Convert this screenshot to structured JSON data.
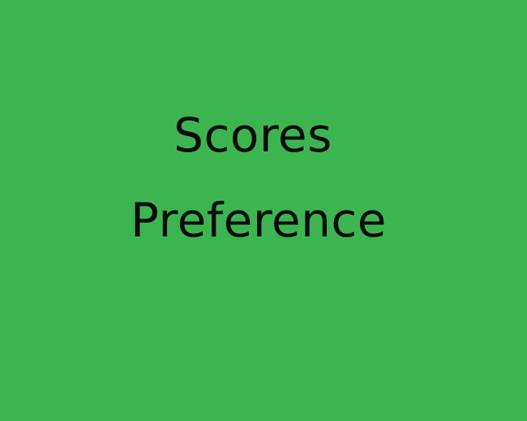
{
  "colors": {
    "background": "#3cb550",
    "text": "#0b0b0b"
  },
  "content": {
    "line1": "Scores",
    "line2": "Preference"
  }
}
